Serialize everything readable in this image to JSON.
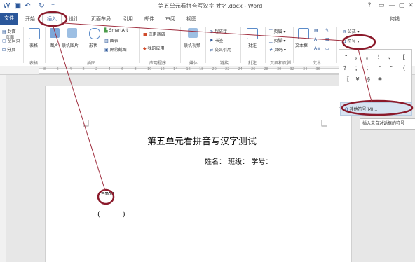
{
  "window": {
    "title": "第五单元看拼音写汉字  姓名.docx - Word",
    "help": "?",
    "minimize": "—",
    "restore": "▢",
    "close": "✕",
    "user": "何钱"
  },
  "tabs": [
    "文件",
    "开始",
    "插入",
    "设计",
    "页面布局",
    "引用",
    "邮件",
    "审阅",
    "视图"
  ],
  "ribbon": {
    "pages": {
      "cover": "封面",
      "blank": "空白页",
      "break": "分页",
      "group": "页面"
    },
    "tables": {
      "table": "表格",
      "group": "表格"
    },
    "illustrations": {
      "picture": "图片",
      "online_picture": "联机图片",
      "shapes": "形状",
      "smartart": "SmartArt",
      "chart": "图表",
      "screenshot": "屏幕截图",
      "group": "插图"
    },
    "apps": {
      "store": "应用商店",
      "my_apps": "我的应用",
      "group": "应用程序"
    },
    "media": {
      "online_video": "联机视频",
      "group": "媒体"
    },
    "links": {
      "hyperlink": "超链接",
      "bookmark": "书签",
      "cross_ref": "交叉引用",
      "group": "链接"
    },
    "comments": {
      "comment": "批注",
      "group": "批注"
    },
    "header_footer": {
      "header": "页眉",
      "footer": "页脚",
      "page_number": "页码",
      "group": "页眉和页脚"
    },
    "text": {
      "textbox": "文本框",
      "group": "文本"
    },
    "symbols": {
      "equation": "公式",
      "symbol": "符号"
    }
  },
  "ruler_numbers": [
    "8",
    "6",
    "4",
    "2",
    "2",
    "4",
    "6",
    "8",
    "10",
    "12",
    "14",
    "16",
    "18",
    "20",
    "22",
    "24",
    "26",
    "28",
    "30",
    "32",
    "34",
    "36"
  ],
  "symbol_panel": {
    "cells": [
      "“",
      "，",
      "。",
      "！",
      "、",
      "【",
      "？",
      "；",
      "：",
      "“",
      "”",
      "（",
      "〖",
      "¥",
      "§",
      "※"
    ],
    "more_symbols": "其他符号(M)...",
    "tooltip": "插入来自对话框的符号"
  },
  "document": {
    "title": "第五单元看拼音写汉字测试",
    "fields": "姓名：    班级：    学号：",
    "pinyin": "fēnxī",
    "paren": "(          )"
  },
  "colors": {
    "accent": "#2b579a",
    "annotation": "#8b1a2b"
  }
}
